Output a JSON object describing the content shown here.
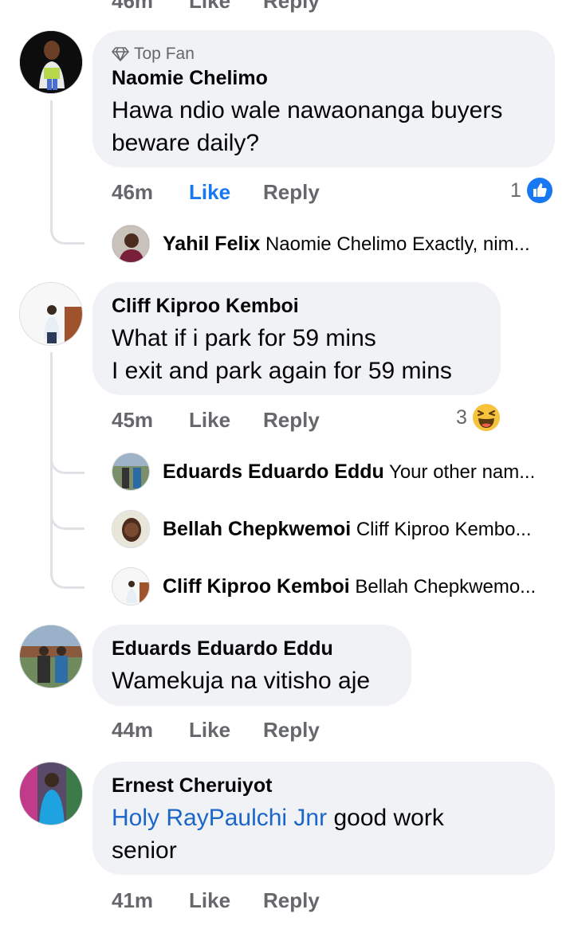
{
  "top_partial": {
    "time": "46m",
    "like": "Like",
    "reply": "Reply"
  },
  "comments": [
    {
      "badge": "Top Fan",
      "author": "Naomie Chelimo",
      "lines": [
        "Hawa ndio wale nawaonanga buyers",
        "beware daily?"
      ],
      "time": "46m",
      "like": "Like",
      "reply": "Reply",
      "reaction_count": "1",
      "reaction_icon": "like-icon",
      "replies": [
        {
          "author": "Yahil Felix",
          "text": "Naomie Chelimo Exactly, nim..."
        }
      ]
    },
    {
      "author": "Cliff Kiproo Kemboi",
      "lines": [
        "What if i park for 59 mins",
        "I exit and park again for 59 mins"
      ],
      "time": "45m",
      "like": "Like",
      "reply": "Reply",
      "reaction_count": "3",
      "reaction_icon": "haha-icon",
      "replies": [
        {
          "author": "Eduards Eduardo Eddu",
          "text": "Your other nam..."
        },
        {
          "author": "Bellah Chepkwemoi",
          "text": "Cliff Kiproo Kembo..."
        },
        {
          "author": "Cliff Kiproo Kemboi",
          "text": "Bellah Chepkwemo..."
        }
      ]
    },
    {
      "author": "Eduards Eduardo Eddu",
      "lines": [
        "Wamekuja na vitisho aje"
      ],
      "time": "44m",
      "like": "Like",
      "reply": "Reply"
    },
    {
      "author": "Ernest Cheruiyot",
      "mention": "Holy RayPaulchi Jnr",
      "line1_rest": " good work",
      "line2": "senior",
      "time": "41m",
      "like": "Like",
      "reply": "Reply"
    }
  ],
  "colors": {
    "bubble": "#f0f2f5",
    "like_active": "#1877f2",
    "mention": "#1b66c9",
    "muted": "#65676b"
  }
}
